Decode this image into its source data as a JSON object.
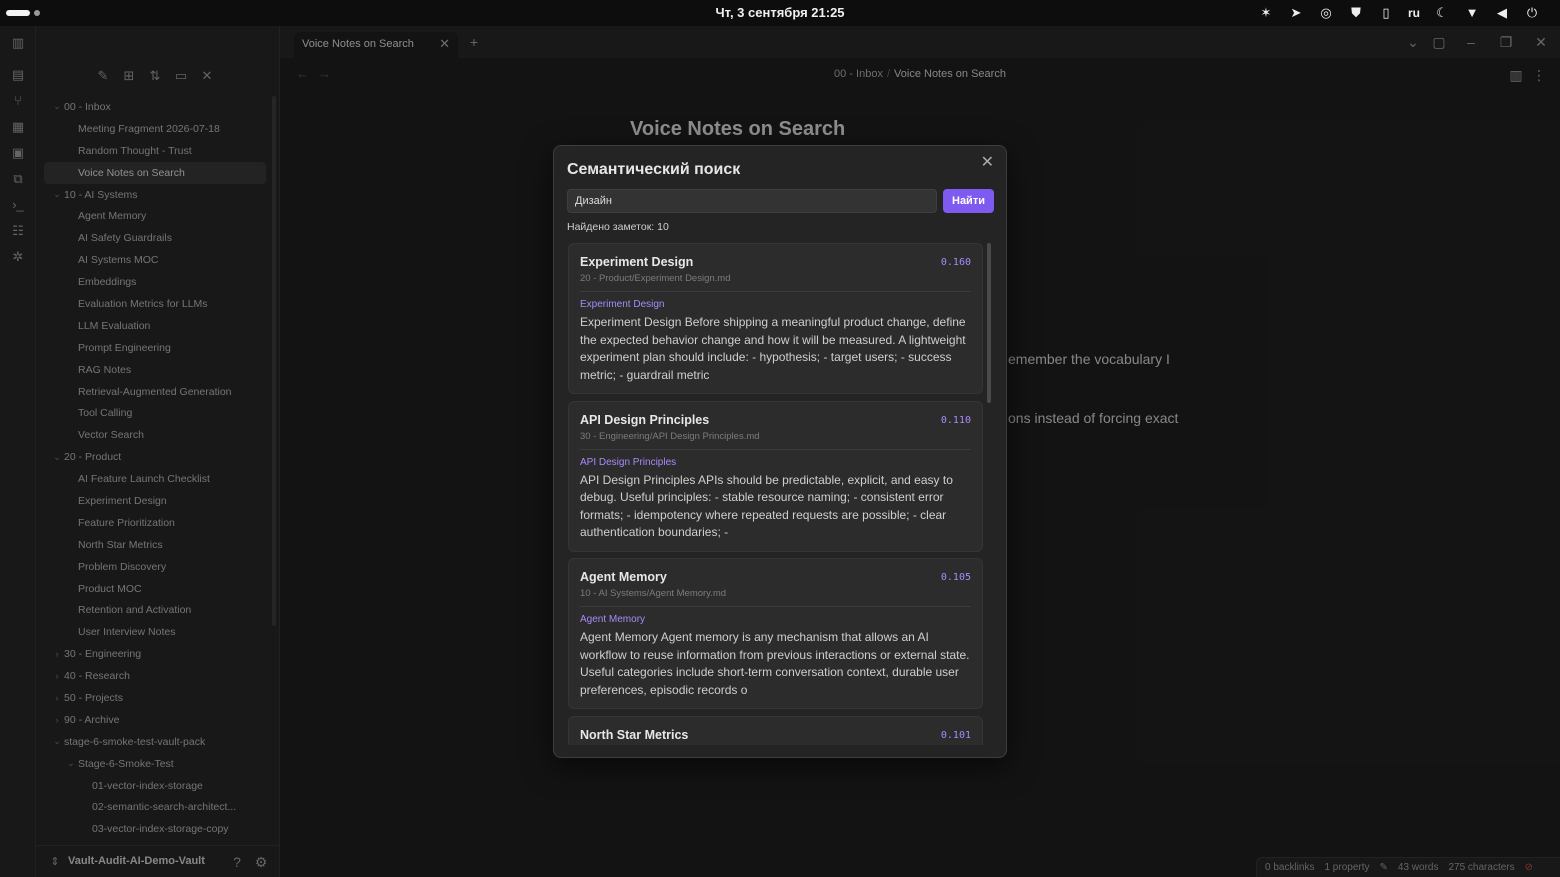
{
  "system": {
    "clock": "Чт, 3 сентября  21:25",
    "lang": "ru"
  },
  "tab": {
    "label": "Voice Notes on Search"
  },
  "breadcrumb": {
    "folder": "00 - Inbox",
    "sep": "/",
    "current": "Voice Notes on Search"
  },
  "document": {
    "title": "Voice Notes on Search",
    "fragment1": "emember the vocabulary I",
    "fragment2": "ons instead of forcing exact"
  },
  "tree": [
    {
      "label": "00 - Inbox",
      "level": 0,
      "chev": "v"
    },
    {
      "label": "Meeting Fragment 2026-07-18",
      "level": 1
    },
    {
      "label": "Random Thought - Trust",
      "level": 1
    },
    {
      "label": "Voice Notes on Search",
      "level": 1,
      "active": true
    },
    {
      "label": "10 - AI Systems",
      "level": 0,
      "chev": "v"
    },
    {
      "label": "Agent Memory",
      "level": 1
    },
    {
      "label": "AI Safety Guardrails",
      "level": 1
    },
    {
      "label": "AI Systems MOC",
      "level": 1
    },
    {
      "label": "Embeddings",
      "level": 1
    },
    {
      "label": "Evaluation Metrics for LLMs",
      "level": 1
    },
    {
      "label": "LLM Evaluation",
      "level": 1
    },
    {
      "label": "Prompt Engineering",
      "level": 1
    },
    {
      "label": "RAG Notes",
      "level": 1
    },
    {
      "label": "Retrieval-Augmented Generation",
      "level": 1
    },
    {
      "label": "Tool Calling",
      "level": 1
    },
    {
      "label": "Vector Search",
      "level": 1
    },
    {
      "label": "20 - Product",
      "level": 0,
      "chev": "v"
    },
    {
      "label": "AI Feature Launch Checklist",
      "level": 1
    },
    {
      "label": "Experiment Design",
      "level": 1
    },
    {
      "label": "Feature Prioritization",
      "level": 1
    },
    {
      "label": "North Star Metrics",
      "level": 1
    },
    {
      "label": "Problem Discovery",
      "level": 1
    },
    {
      "label": "Product MOC",
      "level": 1
    },
    {
      "label": "Retention and Activation",
      "level": 1
    },
    {
      "label": "User Interview Notes",
      "level": 1
    },
    {
      "label": "30 - Engineering",
      "level": 0,
      "chev": ">"
    },
    {
      "label": "40 - Research",
      "level": 0,
      "chev": ">"
    },
    {
      "label": "50 - Projects",
      "level": 0,
      "chev": ">"
    },
    {
      "label": "90 - Archive",
      "level": 0,
      "chev": ">"
    },
    {
      "label": "stage-6-smoke-test-vault-pack",
      "level": 0,
      "chev": "v"
    },
    {
      "label": "Stage-6-Smoke-Test",
      "level": 1,
      "chev": "v"
    },
    {
      "label": "01-vector-index-storage",
      "level": 2
    },
    {
      "label": "02-semantic-search-architect...",
      "level": 2
    },
    {
      "label": "03-vector-index-storage-copy",
      "level": 2
    }
  ],
  "vault": {
    "name": "Vault-Audit-AI-Demo-Vault"
  },
  "status": {
    "backlinks": "0 backlinks",
    "property": "1 property",
    "words": "43 words",
    "chars": "275 characters"
  },
  "modal": {
    "title": "Семантический поиск",
    "query": "Дизайн",
    "button": "Найти",
    "found": "Найдено заметок: 10",
    "results": [
      {
        "title": "Experiment Design",
        "score": "0.160",
        "path": "20 - Product/Experiment Design.md",
        "label": "Experiment Design",
        "text": "Experiment Design Before shipping a meaningful product change, define the expected behavior change and how it will be measured. A lightweight experiment plan should include: - hypothesis; - target users; - success metric; - guardrail metric"
      },
      {
        "title": "API Design Principles",
        "score": "0.110",
        "path": "30 - Engineering/API Design Principles.md",
        "label": "API Design Principles",
        "text": "API Design Principles APIs should be predictable, explicit, and easy to debug. Useful principles: - stable resource naming; - consistent error formats; - idempotency where repeated requests are possible; - clear authentication boundaries; -"
      },
      {
        "title": "Agent Memory",
        "score": "0.105",
        "path": "10 - AI Systems/Agent Memory.md",
        "label": "Agent Memory",
        "text": "Agent Memory Agent memory is any mechanism that allows an AI workflow to reuse information from previous interactions or external state. Useful categories include short-term conversation context, durable user preferences, episodic records o"
      },
      {
        "title": "North Star Metrics",
        "score": "0.101",
        "path": "",
        "label": "",
        "text": ""
      }
    ]
  }
}
